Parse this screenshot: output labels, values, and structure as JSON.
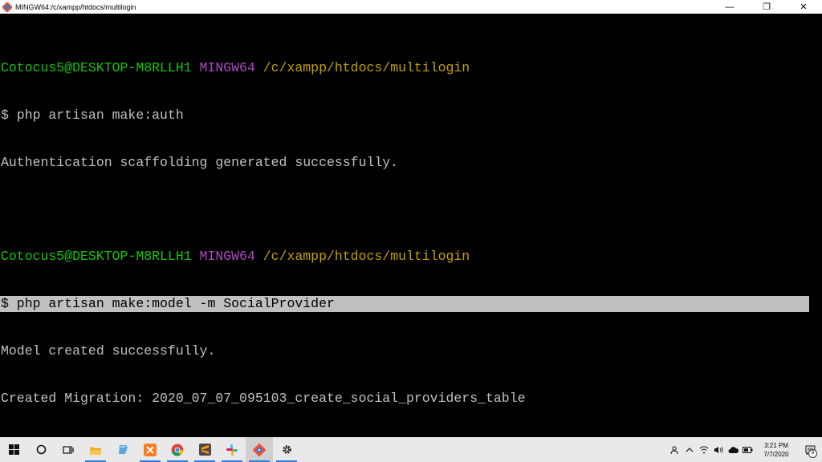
{
  "window": {
    "title": "MINGW64:/c/xampp/htdocs/multilogin",
    "controls": {
      "minimize": "—",
      "restore": "❐",
      "close": "✕"
    }
  },
  "terminal": {
    "lines": [
      {
        "user": "Cotocus5@DESKTOP-M8RLLH1",
        "tag": "MINGW64",
        "path": "/c/xampp/htdocs/multilogin"
      },
      {
        "text": "$ php artisan make:auth"
      },
      {
        "text": "Authentication scaffolding generated successfully."
      },
      {
        "text": ""
      },
      {
        "user": "Cotocus5@DESKTOP-M8RLLH1",
        "tag": "MINGW64",
        "path": "/c/xampp/htdocs/multilogin"
      },
      {
        "text": "$ php artisan make:model -m SocialProvider",
        "highlighted": true
      },
      {
        "text": "Model created successfully."
      },
      {
        "text": "Created Migration: 2020_07_07_095103_create_social_providers_table"
      }
    ]
  },
  "taskbar": {
    "apps": [
      {
        "name": "start-icon"
      },
      {
        "name": "cortana-icon"
      },
      {
        "name": "task-view-icon"
      },
      {
        "name": "file-explorer-icon",
        "active": true
      },
      {
        "name": "notepad-icon"
      },
      {
        "name": "xampp-icon",
        "active": true
      },
      {
        "name": "chrome-icon",
        "active": true
      },
      {
        "name": "sublime-text-icon",
        "active": true
      },
      {
        "name": "slack-icon",
        "active": true
      },
      {
        "name": "git-bash-icon",
        "active": true,
        "current": true
      },
      {
        "name": "settings-icon",
        "active": true
      }
    ],
    "clock": {
      "time": "3:21 PM",
      "date": "7/7/2020"
    },
    "notification_count": "8"
  },
  "colors": {
    "user": "#16c60c",
    "tag": "#b148c6",
    "path": "#c1a000",
    "text": "#c0c0c0",
    "highlight_bg": "#c0c0c0"
  }
}
